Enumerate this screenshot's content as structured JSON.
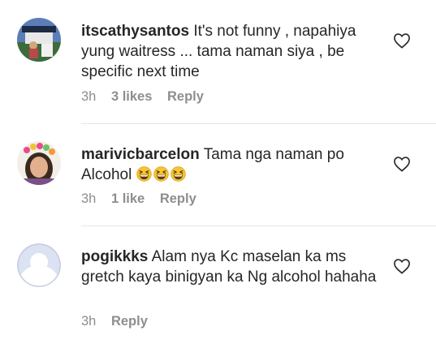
{
  "comments": [
    {
      "username": "itscathysantos",
      "text": "It's not funny , napahiya yung waitress ... tama naman siya , be specific next time",
      "time": "3h",
      "likes": "3 likes",
      "reply": "Reply",
      "avatar_icon": "user-photo-outdoor"
    },
    {
      "username": "marivicbarcelon",
      "text": "Tama nga naman po Alcohol",
      "emoji": "grinning-squinting-face",
      "emoji_count": 3,
      "time": "3h",
      "likes": "1 like",
      "reply": "Reply",
      "avatar_icon": "user-photo-woman-flower-crown"
    },
    {
      "username": "pogikkks",
      "text": "Alam nya Kc maselan ka ms gretch kaya binigyan ka Ng alcohol hahaha",
      "time": "3h",
      "reply": "Reply",
      "avatar_icon": "default-user-silhouette"
    }
  ],
  "colors": {
    "text": "#262626",
    "meta": "#8e8e8e",
    "divider": "#e6e6e6",
    "default_avatar_bg": "#dbe2f2"
  }
}
